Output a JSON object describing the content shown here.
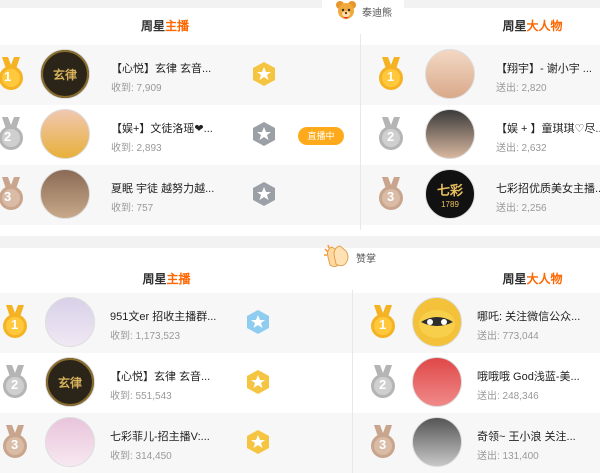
{
  "section1": {
    "gift_name": "泰迪熊",
    "left_title_a": "周星",
    "left_title_b": "主播",
    "right_title_a": "周星",
    "right_title_b": "大人物",
    "anchors": [
      {
        "rank": "1",
        "name": "【心悦】玄律 玄音...",
        "stat": "收到: 7,909",
        "avatar": "玄律"
      },
      {
        "rank": "2",
        "name": "【娱+】文徒洛瑶❤...",
        "stat": "收到: 2,893",
        "live": "直播中"
      },
      {
        "rank": "3",
        "name": "夏眠 宇徒 越努力越...",
        "stat": "收到: 757"
      }
    ],
    "bigshots": [
      {
        "rank": "1",
        "name": "【翔宇】- 谢小宇 ...",
        "stat": "送出: 2,820"
      },
      {
        "rank": "2",
        "name": "【娱 + 】童琪琪♡尽...",
        "stat": "送出: 2,632"
      },
      {
        "rank": "3",
        "name": "七彩招优质美女主播...",
        "stat": "送出: 2,256",
        "avatar": "七彩",
        "avatar_sub": "1789"
      }
    ]
  },
  "section2": {
    "gift_name": "赞掌",
    "left_title_a": "周星",
    "left_title_b": "主播",
    "right_title_a": "周星",
    "right_title_b": "大人物",
    "anchors": [
      {
        "rank": "1",
        "name": "951文er 招收主播群...",
        "stat": "收到: 1,173,523"
      },
      {
        "rank": "2",
        "name": "【心悦】玄律 玄音...",
        "stat": "收到: 551,543",
        "avatar": "玄律"
      },
      {
        "rank": "3",
        "name": "七彩菲儿-招主播V:...",
        "stat": "收到: 314,450"
      }
    ],
    "bigshots": [
      {
        "rank": "1",
        "name": "哪吒: 关注微信公众...",
        "stat": "送出: 773,044"
      },
      {
        "rank": "2",
        "name": "哦哦哦 God浅蓝-美...",
        "stat": "送出: 248,346"
      },
      {
        "rank": "3",
        "name": "奇领~ 王小浪 关注...",
        "stat": "送出: 131,400"
      }
    ]
  },
  "colors": {
    "accent": "#ff6600",
    "gold": "#f5b324",
    "silver": "#b5b5b5",
    "bronze": "#c8a58c",
    "live": "#ffaa1a"
  }
}
